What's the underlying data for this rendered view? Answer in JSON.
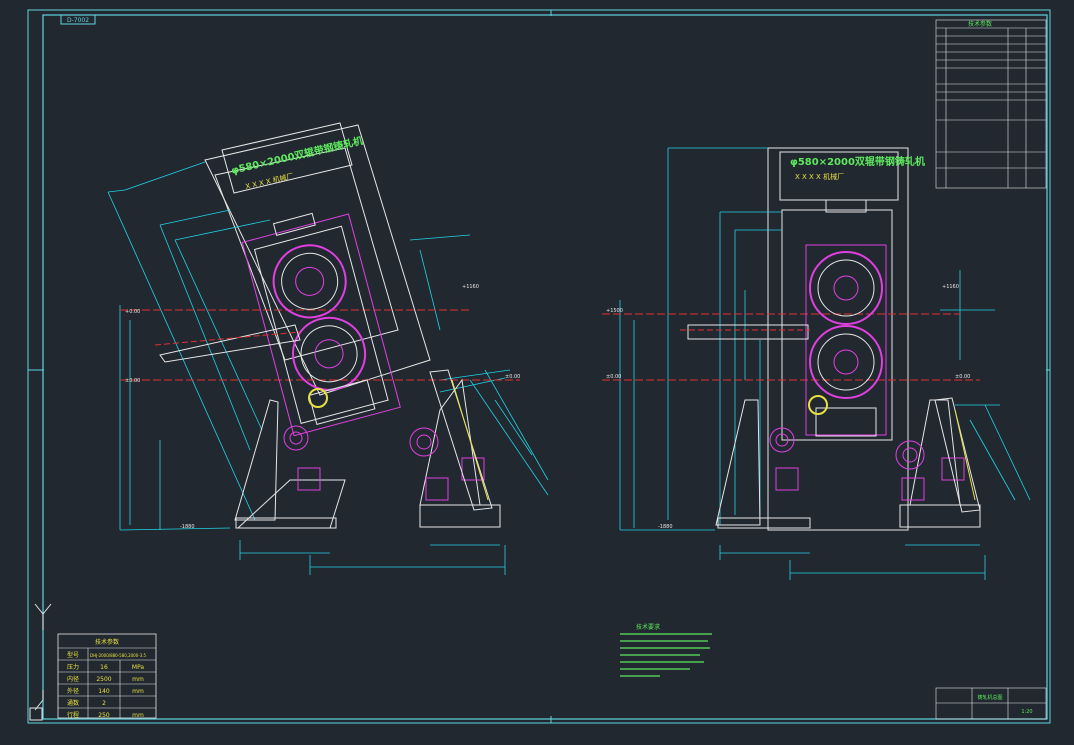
{
  "colors": {
    "background": "#212830",
    "frame": "#5fd4e0",
    "outline": "#e6e6e6",
    "dimension": "#22d3e6",
    "machine": "#e040e0",
    "red": "#e03030",
    "green": "#5ee85e",
    "yellow": "#e8e040"
  },
  "sheet": {
    "drawing_number_tag": "D-7002",
    "left_view": {
      "title_plate": "φ580×2000双辊带钢铸轧机",
      "maker_plate": "X X X X 机械厂",
      "level_ref_left": "±0.00",
      "level_ref_right": "±0.00",
      "level_top_left": "+0.00",
      "level_top_right": "+1160",
      "level_bottom": "-1880"
    },
    "right_view": {
      "title_plate": "φ580×2000双辊带钢铸轧机",
      "maker_plate": "X X X X 机械厂",
      "level_ref_left": "±0.00",
      "level_ref_right": "±0.00",
      "level_top_left": "+1500",
      "level_top_right": "+1160",
      "level_bottom": "-1880"
    },
    "parameter_table": {
      "title": "技术参数",
      "rows": [
        [
          "型号",
          "DHJ-2000/880-580,2000-3.5"
        ],
        [
          "压力",
          "16",
          "MPa"
        ],
        [
          "内径",
          "2500",
          "mm"
        ],
        [
          "外径",
          "140",
          "mm"
        ],
        [
          "通数",
          "2",
          ""
        ],
        [
          "行程",
          "250",
          "mm"
        ]
      ]
    },
    "tech_block_title": "技术参数",
    "note_title": "技术要求",
    "title_block": {
      "name": "铸轧机总图",
      "scale": "1:20"
    }
  }
}
